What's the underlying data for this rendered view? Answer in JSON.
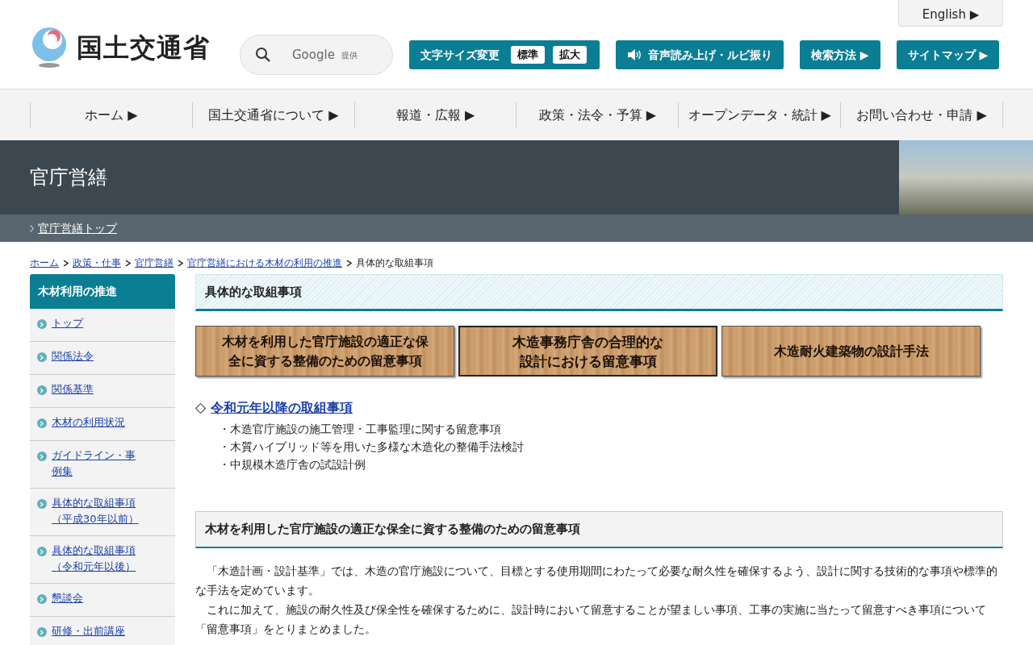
{
  "header": {
    "logo_text": "国土交通省",
    "search": {
      "placeholder": "Google",
      "provider": "提供"
    },
    "english_link": "English ▶",
    "font_size": {
      "label": "文字サイズ変更",
      "options": [
        {
          "label": "標準"
        },
        {
          "label": "拡大"
        }
      ]
    },
    "buttons": [
      {
        "kind": "speaker",
        "label": "音声読み上げ・ルビ振り"
      },
      {
        "kind": "plain",
        "label": "検索方法 ▶"
      },
      {
        "kind": "plain",
        "label": "サイトマップ ▶"
      }
    ]
  },
  "global_nav": [
    "ホーム ▶",
    "国土交通省について ▶",
    "報道・広報 ▶",
    "政策・法令・予算 ▶",
    "オープンデータ・統計 ▶",
    "お問い合わせ・申請 ▶"
  ],
  "section_banner": {
    "title": "官庁営繕",
    "sub_link": "官庁営繕トップ"
  },
  "breadcrumb": {
    "links": [
      "ホーム",
      "政策・仕事",
      "官庁営繕",
      "官庁営繕における木材の利用の推進"
    ],
    "current": "具体的な取組事項"
  },
  "sidebar": {
    "title": "木材利用の推進",
    "items": [
      "トップ",
      "関係法令",
      "関係基準",
      "木材の利用状況",
      "ガイドライン・事例集",
      "具体的な取組事項（平成30年以前）",
      "具体的な取組事項（令和元年以後）",
      "懇談会",
      "研修・出前講座"
    ]
  },
  "main": {
    "title": "具体的な取組事項",
    "wood_buttons": [
      {
        "label": "木材を利用した官庁施設の適正な保全に資する整備のための留意事項",
        "selected": false
      },
      {
        "label": "木造事務庁舎の合理的な設計における留意事項",
        "selected": true
      },
      {
        "label": "木造耐火建築物の設計手法",
        "selected": false
      }
    ],
    "recent": {
      "marker": "◇",
      "link": "令和元年以降の取組事項",
      "items": [
        "・木造官庁施設の施工管理・工事監理に関する留意事項",
        "・木質ハイブリッド等を用いた多様な木造化の整備手法検討",
        "・中規模木造庁舎の試設計例"
      ]
    },
    "section": {
      "title": "木材を利用した官庁施設の適正な保全に資する整備のための留意事項",
      "paragraphs": [
        "　「木造計画・設計基準」では、木造の官庁施設について、目標とする使用期間にわたって必要な耐久性を確保するよう、設計に関する技術的な事項や標準的な手法を定めています。",
        "　これに加えて、施設の耐久性及び保全性を確保するために、設計時において留意することが望ましい事項、工事の実施に当たって留意すべき事項について「留意事項」をとりまとめました。"
      ]
    }
  }
}
